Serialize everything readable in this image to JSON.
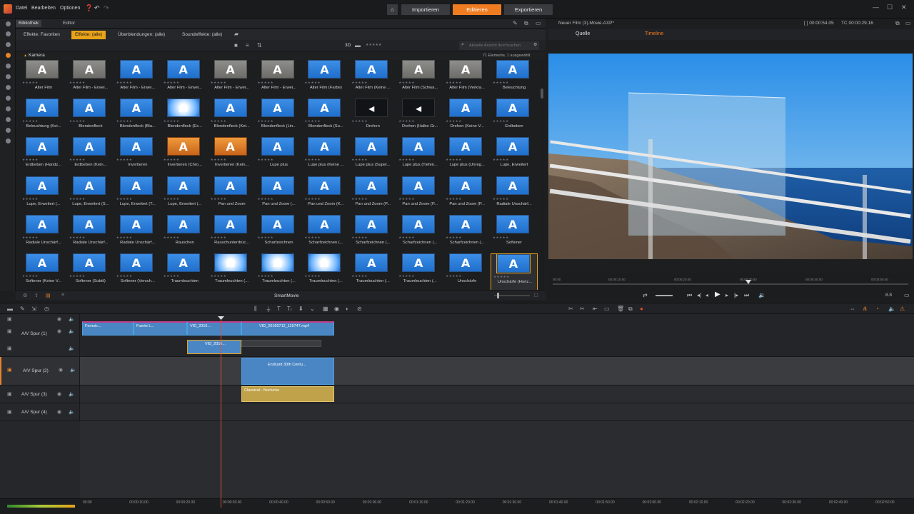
{
  "menu": {
    "datei": "Datei",
    "bearbeiten": "Bearbeiten",
    "optionen": "Optionen"
  },
  "modes": {
    "importieren": "Importieren",
    "editieren": "Editieren",
    "exportieren": "Exportieren"
  },
  "colors": {
    "accent": "#f07c22",
    "tab_active": "#e8a319",
    "clip_blue": "#4a86c4",
    "playhead": "#e04c32"
  },
  "library": {
    "bibliothek": "Bibliothek",
    "editor": "Editor",
    "tabs": [
      "Effekte: Favoriten",
      "Effekte: (alle)",
      "Überblendungen: (alle)",
      "Soundeffekte: (alle)"
    ],
    "view_3d": "3D",
    "search_placeholder": "Aktuelle Ansicht durchsuchen",
    "category": "Kamera",
    "count": "71 Elemente, 1 ausgewählt",
    "footer": "SmartMovie",
    "tiles": [
      {
        "label": "Alter Film",
        "style": "gray"
      },
      {
        "label": "Alter Film - Erwei...",
        "style": "gray"
      },
      {
        "label": "Alter Film - Erwei...",
        "style": "blue"
      },
      {
        "label": "Alter Film - Erwei...",
        "style": "blue"
      },
      {
        "label": "Alter Film - Erwei...",
        "style": "gray"
      },
      {
        "label": "Alter Film - Erwei...",
        "style": "gray"
      },
      {
        "label": "Alter Film (Farbe)",
        "style": "blue"
      },
      {
        "label": "Alter Film (Keine ...",
        "style": "blue"
      },
      {
        "label": "Alter Film (Schwa...",
        "style": "gray"
      },
      {
        "label": "Alter Film (Verkra...",
        "style": "gray"
      },
      {
        "label": "Beleuchtung",
        "style": "blue"
      },
      {
        "label": "Beleuchtung (Kei...",
        "style": "blue"
      },
      {
        "label": "Blendenfleck",
        "style": "blue"
      },
      {
        "label": "Blendenfleck (Bla...",
        "style": "blue"
      },
      {
        "label": "Blendenfleck (Ex...",
        "style": "white"
      },
      {
        "label": "Blendenfleck (Kei...",
        "style": "blue"
      },
      {
        "label": "Blendenfleck (Lin...",
        "style": "blue"
      },
      {
        "label": "Blendenfleck (Su...",
        "style": "blue"
      },
      {
        "label": "Drehen",
        "style": "dark"
      },
      {
        "label": "Drehen (Halbe Gr...",
        "style": "dark"
      },
      {
        "label": "Drehen (Keine V...",
        "style": "blue"
      },
      {
        "label": "Erdbeben",
        "style": "blue"
      },
      {
        "label": "Erdbeben (Handz...",
        "style": "blue"
      },
      {
        "label": "Erdbeben (Kein...",
        "style": "blue"
      },
      {
        "label": "Invertieren",
        "style": "blue"
      },
      {
        "label": "Invertieren (Chro...",
        "style": "orange"
      },
      {
        "label": "Invertieren (Kein...",
        "style": "orange"
      },
      {
        "label": "Lupe plus",
        "style": "blue"
      },
      {
        "label": "Lupe plus (Keine ...",
        "style": "blue"
      },
      {
        "label": "Lupe plus (Super...",
        "style": "blue"
      },
      {
        "label": "Lupe plus (Tiefen...",
        "style": "blue"
      },
      {
        "label": "Lupe plus (Unreg...",
        "style": "blue"
      },
      {
        "label": "Lupe, Erweitert",
        "style": "blue"
      },
      {
        "label": "Lupe, Erweitert (...",
        "style": "blue"
      },
      {
        "label": "Lupe, Erweitert (S...",
        "style": "blue"
      },
      {
        "label": "Lupe, Erweitert (T...",
        "style": "blue"
      },
      {
        "label": "Lupe, Erweitert (...",
        "style": "blue"
      },
      {
        "label": "Pan und Zoom",
        "style": "blue"
      },
      {
        "label": "Pan und Zoom (...",
        "style": "blue"
      },
      {
        "label": "Pan und Zoom (K...",
        "style": "blue"
      },
      {
        "label": "Pan und Zoom (P...",
        "style": "blue"
      },
      {
        "label": "Pan und Zoom (P...",
        "style": "blue"
      },
      {
        "label": "Pan und Zoom (P...",
        "style": "blue"
      },
      {
        "label": "Radiale Unschärf...",
        "style": "blue"
      },
      {
        "label": "Radiale Unschärf...",
        "style": "blue"
      },
      {
        "label": "Radiale Unschärf...",
        "style": "blue"
      },
      {
        "label": "Radiale Unschärf...",
        "style": "blue"
      },
      {
        "label": "Rauschen",
        "style": "blue"
      },
      {
        "label": "Rauschunterdrüc...",
        "style": "blue"
      },
      {
        "label": "Scharfzeichnen",
        "style": "blue"
      },
      {
        "label": "Scharfzeichnen (...",
        "style": "blue"
      },
      {
        "label": "Scharfzeichnen (...",
        "style": "blue"
      },
      {
        "label": "Scharfzeichnen (...",
        "style": "blue"
      },
      {
        "label": "Scharfzeichnen (...",
        "style": "blue"
      },
      {
        "label": "Softener",
        "style": "blue"
      },
      {
        "label": "Softener (Keine V...",
        "style": "blue"
      },
      {
        "label": "Softener (Subtil)",
        "style": "blue"
      },
      {
        "label": "Softener (Versch...",
        "style": "blue"
      },
      {
        "label": "Traumleuchten",
        "style": "blue"
      },
      {
        "label": "Traumleuchten (...",
        "style": "white"
      },
      {
        "label": "Traumleuchten (...",
        "style": "white"
      },
      {
        "label": "Traumleuchten (...",
        "style": "white"
      },
      {
        "label": "Traumleuchten (...",
        "style": "blue"
      },
      {
        "label": "Traumleuchten (...",
        "style": "blue"
      },
      {
        "label": "Unschärfe",
        "style": "blue"
      },
      {
        "label": "Unschärfe (Horiz...",
        "style": "blue",
        "selected": true
      }
    ]
  },
  "preview": {
    "title": "Neuer Film (3).Movie.AXP*",
    "duration": "[ ] 00:00:54.05",
    "timecode": "TC 00:00:29.16",
    "tab_source": "Quelle",
    "tab_timeline": "Timeline",
    "ruler": [
      "00:00",
      "00:00:10.00",
      "00:00:20.00",
      "00:00:30.00",
      "00:00:40.00",
      "00:00:50.00"
    ],
    "quality": "8.8"
  },
  "timeline": {
    "tracks": [
      {
        "name": "A/V Spur (1)"
      },
      {
        "name": "A/V Spur (2)"
      },
      {
        "name": "A/V Spur (3)"
      },
      {
        "name": "A/V Spur (4)"
      }
    ],
    "clips": {
      "c1": "Fernsic...",
      "c2": "Fuerte L...",
      "c3": "VID_2016...",
      "c4": "VID_20160712_115747.mp4",
      "c5": "VID_2016...",
      "c6": "Endcard 30th Centu...",
      "c7": "Classical - Nocturne"
    },
    "ruler": [
      "00:00",
      "00:00:10.00",
      "00:00:20.00",
      "00:00:30.00",
      "00:00:40.00",
      "00:00:50.00",
      "00:01:00.00",
      "00:01:10.00",
      "00:01:20.00",
      "00:01:30.00",
      "00:01:40.00",
      "00:01:50.00",
      "00:02:00.00",
      "00:02:10.00",
      "00:02:20.00",
      "00:02:30.00",
      "00:02:40.00",
      "00:02:50.00"
    ]
  }
}
